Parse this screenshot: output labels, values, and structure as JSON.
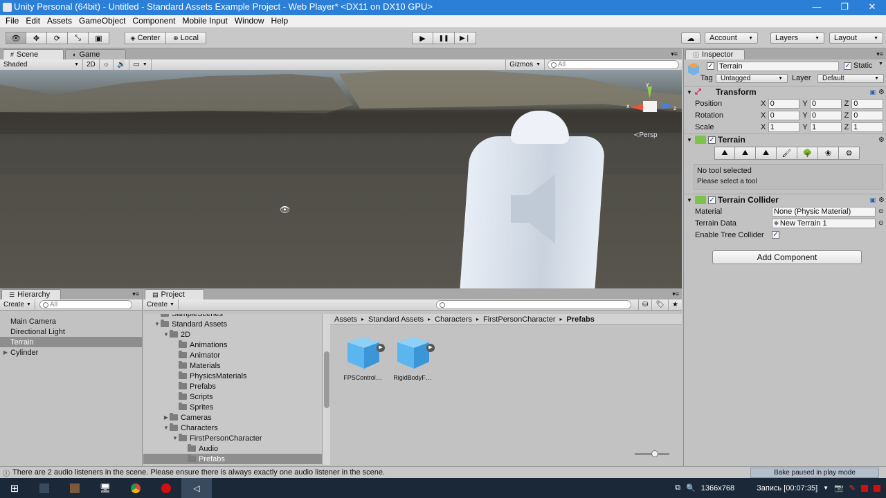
{
  "window": {
    "title": "Unity Personal (64bit) - Untitled - Standard Assets Example Project - Web Player* <DX11 on DX10 GPU>",
    "controls": [
      "—",
      "❐",
      "✕"
    ]
  },
  "menu": [
    "File",
    "Edit",
    "Assets",
    "GameObject",
    "Component",
    "Mobile Input",
    "Window",
    "Help"
  ],
  "toolbar": {
    "tools": [
      {
        "icon": "eye-icon",
        "glyph": "👁"
      },
      {
        "icon": "move-icon",
        "glyph": "✥"
      },
      {
        "icon": "rotate-icon",
        "glyph": "⟳"
      },
      {
        "icon": "scale-icon",
        "glyph": "⤡"
      },
      {
        "icon": "rect-icon",
        "glyph": "▣"
      }
    ],
    "pivot": "Center",
    "space": "Local",
    "play": "▶",
    "pause": "❚❚",
    "step": "▶❘",
    "cloud_icon": "cloud-icon",
    "account": "Account",
    "layers": "Layers",
    "layout": "Layout"
  },
  "scene": {
    "tabs": [
      "Scene",
      "Game"
    ],
    "shading": "Shaded",
    "mode2d": "2D",
    "gizmos": "Gizmos",
    "search_placeholder": "All",
    "persp": "Persp"
  },
  "hierarchy": {
    "title": "Hierarchy",
    "create": "Create",
    "search_placeholder": "All",
    "items": [
      {
        "label": "Main Camera",
        "selected": false,
        "expandable": false
      },
      {
        "label": "Directional Light",
        "selected": false,
        "expandable": false
      },
      {
        "label": "Terrain",
        "selected": true,
        "expandable": false
      },
      {
        "label": "Cylinder",
        "selected": false,
        "expandable": true
      }
    ]
  },
  "project": {
    "title": "Project",
    "create": "Create",
    "tree": [
      {
        "label": "SampleScenes",
        "depth": 1,
        "arrow": ""
      },
      {
        "label": "Standard Assets",
        "depth": 1,
        "arrow": "▼"
      },
      {
        "label": "2D",
        "depth": 2,
        "arrow": "▼"
      },
      {
        "label": "Animations",
        "depth": 3,
        "arrow": ""
      },
      {
        "label": "Animator",
        "depth": 3,
        "arrow": ""
      },
      {
        "label": "Materials",
        "depth": 3,
        "arrow": ""
      },
      {
        "label": "PhysicsMaterials",
        "depth": 3,
        "arrow": ""
      },
      {
        "label": "Prefabs",
        "depth": 3,
        "arrow": ""
      },
      {
        "label": "Scripts",
        "depth": 3,
        "arrow": ""
      },
      {
        "label": "Sprites",
        "depth": 3,
        "arrow": ""
      },
      {
        "label": "Cameras",
        "depth": 2,
        "arrow": "▶"
      },
      {
        "label": "Characters",
        "depth": 2,
        "arrow": "▼"
      },
      {
        "label": "FirstPersonCharacter",
        "depth": 3,
        "arrow": "▼"
      },
      {
        "label": "Audio",
        "depth": 4,
        "arrow": ""
      },
      {
        "label": "Prefabs",
        "depth": 4,
        "arrow": "",
        "selected": true
      }
    ],
    "breadcrumb": [
      "Assets",
      "Standard Assets",
      "Characters",
      "FirstPersonCharacter",
      "Prefabs"
    ],
    "assets": [
      "FPSControl…",
      "RigidBodyF…"
    ]
  },
  "inspector": {
    "title": "Inspector",
    "object_name": "Terrain",
    "static_label": "Static",
    "tag_label": "Tag",
    "tag_value": "Untagged",
    "layer_label": "Layer",
    "layer_value": "Default",
    "transform": {
      "title": "Transform",
      "rows": [
        {
          "label": "Position",
          "x": "0",
          "y": "0",
          "z": "0"
        },
        {
          "label": "Rotation",
          "x": "0",
          "y": "0",
          "z": "0"
        },
        {
          "label": "Scale",
          "x": "1",
          "y": "1",
          "z": "1"
        }
      ]
    },
    "terrain": {
      "title": "Terrain",
      "tool_icons": [
        "raise-terrain-icon",
        "paint-height-icon",
        "smooth-height-icon",
        "paint-texture-icon",
        "place-trees-icon",
        "paint-details-icon",
        "terrain-settings-icon"
      ],
      "tool_glyphs": [
        "⛰",
        "⛰",
        "⛰",
        "🖌",
        "🌳",
        "❀",
        "⚙"
      ],
      "message_title": "No tool selected",
      "message_body": "Please select a tool"
    },
    "collider": {
      "title": "Terrain Collider",
      "material_label": "Material",
      "material_value": "None (Physic Material)",
      "data_label": "Terrain Data",
      "data_value": "New Terrain 1",
      "tree_label": "Enable Tree Collider"
    },
    "add_component": "Add Component"
  },
  "status": {
    "message": "There are 2 audio listeners in the scene. Please ensure there is always exactly one audio listener in the scene.",
    "bake": "Bake paused in play mode"
  },
  "taskbar": {
    "resolution": "1366x768",
    "recording": "Запись [00:07:35]"
  }
}
